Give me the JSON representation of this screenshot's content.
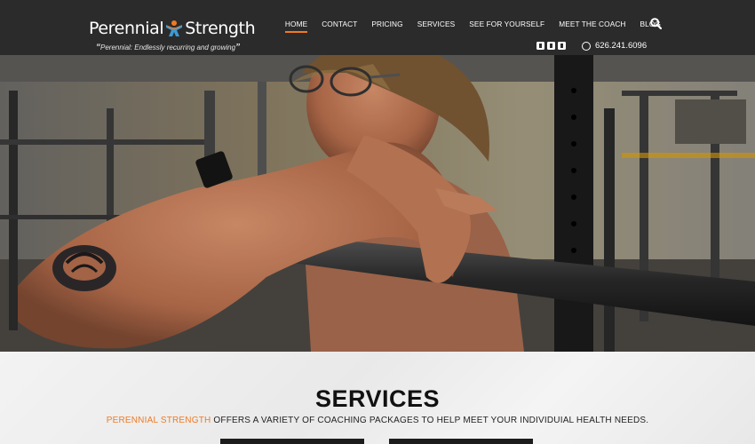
{
  "brand": {
    "name_part1": "Perennial",
    "name_part2": "Strength",
    "tagline": "Perennial: Endlessly recurring and growing",
    "accent_color": "#f07a22"
  },
  "nav": {
    "items": [
      {
        "label": "HOME",
        "active": true
      },
      {
        "label": "CONTACT"
      },
      {
        "label": "PRICING"
      },
      {
        "label": "SERVICES"
      },
      {
        "label": "SEE FOR YOURSELF"
      },
      {
        "label": "MEET THE COACH"
      },
      {
        "label": "BLOG"
      }
    ],
    "search_icon": "search-icon"
  },
  "social": {
    "icons": [
      "facebook-icon",
      "twitter-icon",
      "instagram-icon"
    ],
    "phone_icon": "whatsapp-icon",
    "phone": "626.241.6096"
  },
  "hero": {
    "image": "woman-front-squat-barbell-gym-photo"
  },
  "services": {
    "title": "SERVICES",
    "subtitle_brand": "PERENNIAL STRENGTH",
    "subtitle_rest": " OFFERS A VARIETY OF COACHING PACKAGES TO HELP MEET YOUR INDIVIDUIAL HEALTH NEEDS."
  }
}
